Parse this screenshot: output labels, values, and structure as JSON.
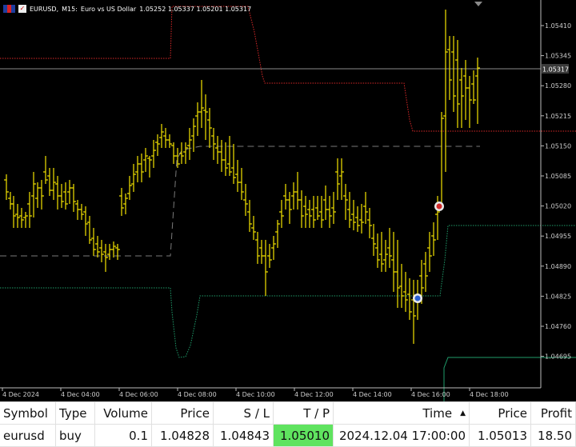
{
  "chart": {
    "header": {
      "symbol": "EURUSD",
      "timeframe": "M15",
      "description": "Euro vs US Dollar",
      "ohlc": "1.05252 1.05337 1.05201 1.05317"
    },
    "colors": {
      "background": "#000000",
      "candle": "#f5e400",
      "upper_band": "#d62828",
      "lower_band": "#1f9b6a",
      "middle_line": "#8a8a8a",
      "price_line": "#8a8a8a",
      "axis_text": "#cccccc"
    },
    "current_price": "1.05317",
    "price_axis": {
      "labels": [
        "1.05410",
        "1.05345",
        "1.05280",
        "1.05215",
        "1.05150",
        "1.05085",
        "1.05020",
        "1.04955",
        "1.04890",
        "1.04825",
        "1.04760",
        "1.04695"
      ]
    },
    "time_axis": {
      "labels": [
        "4 Dec 2024",
        "4 Dec 04:00",
        "4 Dec 06:00",
        "4 Dec 08:00",
        "4 Dec 10:00",
        "4 Dec 12:00",
        "4 Dec 14:00",
        "4 Dec 16:00",
        "4 Dec 18:00"
      ]
    },
    "trade_markers": [
      {
        "icon": "buy-entry-icon",
        "price": 1.04828
      },
      {
        "icon": "take-profit-exit-icon",
        "price": 1.0501
      }
    ]
  },
  "positions": {
    "columns": [
      {
        "label": "Symbol",
        "align": "left"
      },
      {
        "label": "Type",
        "align": "left"
      },
      {
        "label": "Volume",
        "align": "right"
      },
      {
        "label": "Price",
        "align": "right"
      },
      {
        "label": "S / L",
        "align": "right"
      },
      {
        "label": "T / P",
        "align": "right"
      },
      {
        "label": "Time",
        "align": "right",
        "sort_icon": "sort-ascending-icon"
      },
      {
        "label": "Price",
        "align": "right"
      },
      {
        "label": "Profit",
        "align": "right"
      }
    ],
    "rows": [
      {
        "symbol": "eurusd",
        "type": "buy",
        "volume": "0.1",
        "open_price": "1.04828",
        "sl": "1.04843",
        "tp": "1.05010",
        "time": "2024.12.04 17:00:00",
        "close_price": "1.05013",
        "profit": "18.50"
      }
    ]
  }
}
